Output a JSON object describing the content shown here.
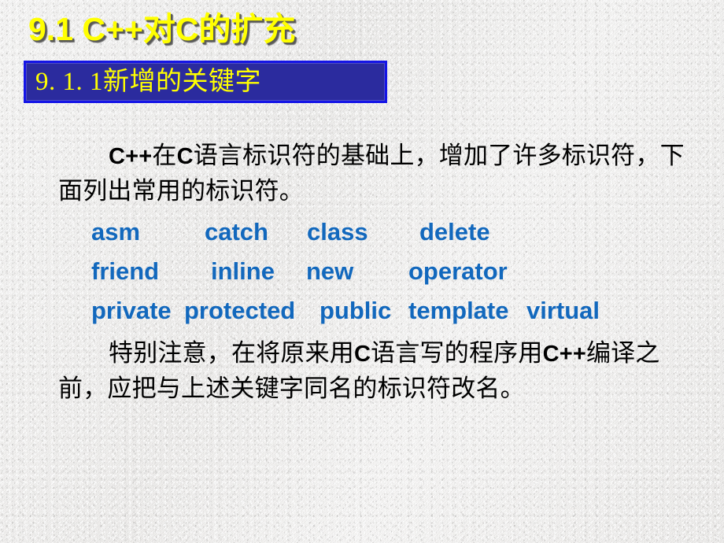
{
  "slide": {
    "title": "9.1 C++对C的扩充",
    "subtitle": "9. 1. 1新增的关键字",
    "paragraphs": {
      "intro_line1_latin": "C++",
      "intro_line1_rest": "在",
      "intro_line1_latin2": "C",
      "intro_text": "语言标识符的基础上，增加了许多标识符，下面列出常用的标识符。",
      "note_part1": "特别注意，在将原来用",
      "note_latin1": "C",
      "note_part2": "语言写的程序用",
      "note_latin2": "C++",
      "note_part3": "编译之前，应把与上述关键字同名的标识符改名。"
    },
    "keyword_rows": [
      [
        "asm",
        "catch",
        "class",
        "delete"
      ],
      [
        "friend",
        "inline",
        "new",
        "operator"
      ],
      [
        "private",
        "protected",
        "public",
        "template",
        "virtual"
      ]
    ],
    "colors": {
      "title_text": "#ffff00",
      "title_shadow": "#585858",
      "subtitle_text": "#ffff00",
      "subtitle_fill": "#2b2b9e",
      "subtitle_border": "#1414e6",
      "keyword_text": "#1268bd",
      "body_text": "#000000",
      "background": "#e9e8e6"
    }
  }
}
